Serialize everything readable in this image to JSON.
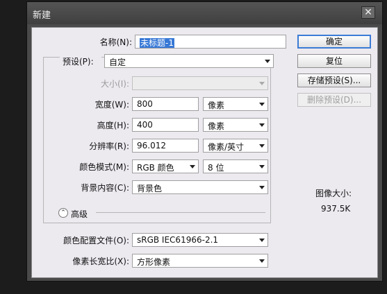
{
  "window": {
    "title": "新建",
    "close_symbol": "✕"
  },
  "fields": {
    "name": {
      "label": "名称(N):",
      "value": "未标题-1"
    },
    "preset": {
      "label": "预设(P):",
      "value": "自定"
    },
    "size": {
      "label": "大小(I):",
      "value": ""
    },
    "width": {
      "label": "宽度(W):",
      "value": "800",
      "unit": "像素"
    },
    "height": {
      "label": "高度(H):",
      "value": "400",
      "unit": "像素"
    },
    "resolution": {
      "label": "分辨率(R):",
      "value": "96.012",
      "unit": "像素/英寸"
    },
    "color_mode": {
      "label": "颜色模式(M):",
      "value": "RGB 颜色",
      "depth": "8 位"
    },
    "background": {
      "label": "背景内容(C):",
      "value": "背景色"
    },
    "advanced_label": "高级",
    "color_profile": {
      "label": "颜色配置文件(O):",
      "value": "sRGB IEC61966-2.1"
    },
    "pixel_aspect": {
      "label": "像素长宽比(X):",
      "value": "方形像素"
    }
  },
  "buttons": {
    "ok": "确定",
    "reset": "复位",
    "save_preset": "存储预设(S)...",
    "delete_preset": "删除预设(D)..."
  },
  "image_size": {
    "label": "图像大小:",
    "value": "937.5K"
  }
}
